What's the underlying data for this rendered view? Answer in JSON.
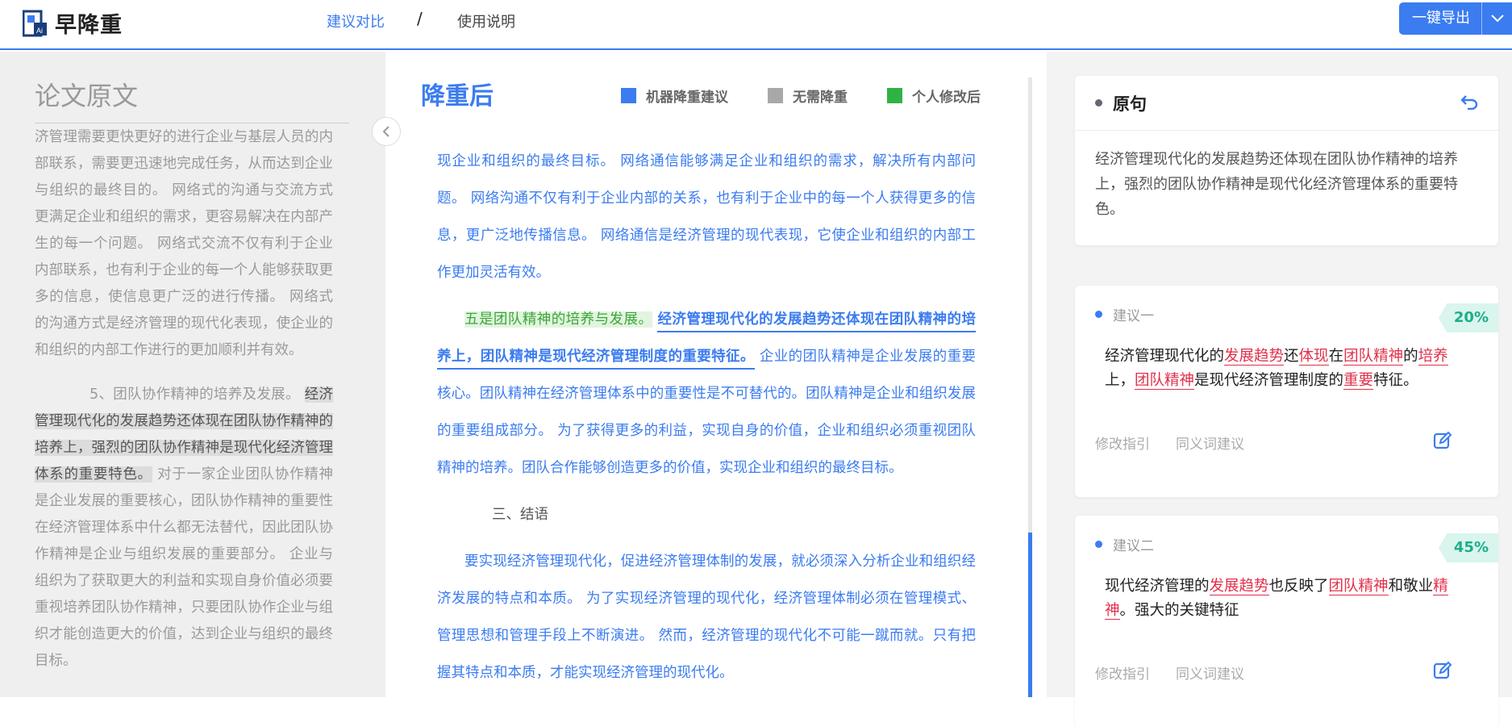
{
  "header": {
    "logo_text": "早降重",
    "nav_compare": "建议对比",
    "nav_separator": "/",
    "nav_guide": "使用说明",
    "export_label": "一键导出"
  },
  "left": {
    "title": "论文原文",
    "p1": "济管理需要更快更好的进行企业与基层人员的内部联系，需要更迅速地完成任务，从而达到企业与组织的最终目的。 网络式的沟通与交流方式更满足企业和组织的需求，更容易解决在内部产生的每一个问题。 网络式交流不仅有利于企业内部联系，也有利于企业的每一个人能够获取更多的信息，使信息更广泛的进行传播。 网络式的沟通方式是经济管理的现代化表现，使企业的和组织的内部工作进行的更加顺利并有效。",
    "p2_lead": "5、团队协作精神的培养及发展。",
    "p2_highlight": "经济管理现代化的发展趋势还体现在团队协作精神的培养上，强烈的团队协作精神是现代化经济管理体系的重要特色。",
    "p2_rest": "对于一家企业团队协作精神是企业发展的重要核心，团队协作精神的重要性在经济管理体系中什么都无法替代，因此团队协作精神是企业与组织发展的重要部分。 企业与组织为了获取更大的利益和实现自身价值必须要重视培养团队协作精神，只要团队协作企业与组织才能创造更大的价值，达到企业与组织的最终目标。"
  },
  "middle": {
    "title": "降重后",
    "legend": [
      {
        "label": "机器降重建议",
        "color": "#3b7cf0"
      },
      {
        "label": "无需降重",
        "color": "#a8a8a8"
      },
      {
        "label": "个人修改后",
        "color": "#2fb344"
      }
    ],
    "p1": "现企业和组织的最终目标。 网络通信能够满足企业和组织的需求，解决所有内部问题。 网络沟通不仅有利于企业内部的关系，也有利于企业中的每一个人获得更多的信息，更广泛地传播信息。 网络通信是经济管理的现代表现，它使企业和组织的内部工作更加灵活有效。",
    "p2_green": "五是团队精神的培养与发展。",
    "p2_selected": "经济管理现代化的发展趋势还体现在团队精神的培养上，团队精神是现代经济管理制度的重要特征。",
    "p2_rest": "企业的团队精神是企业发展的重要核心。团队精神在经济管理体系中的重要性是不可替代的。团队精神是企业和组织发展的重要组成部分。 为了获得更多的利益，实现自身的价值，企业和组织必须重视团队精神的培养。团队合作能够创造更多的价值，实现企业和组织的最终目标。",
    "heading": "三、结语",
    "p3": "要实现经济管理现代化，促进经济管理体制的发展，就必须深入分析企业和组织经济发展的特点和本质。 为了实现经济管理的现代化，经济管理体制必须在管理模式、管理思想和管理手段上不断演进。 然而，经济管理的现代化不可能一蹴而就。只有把握其特点和本质，才能实现经济管理的现代化。"
  },
  "right": {
    "orig_title": "原句",
    "orig_text": "经济管理现代化的发展趋势还体现在团队协作精神的培养上，强烈的团队协作精神是现代化经济管理体系的重要特色。",
    "foot_guide": "修改指引",
    "foot_synonym": "同义词建议",
    "suggestions": [
      {
        "name": "建议一",
        "percent": "20%"
      },
      {
        "name": "建议二",
        "percent": "45%"
      }
    ]
  }
}
